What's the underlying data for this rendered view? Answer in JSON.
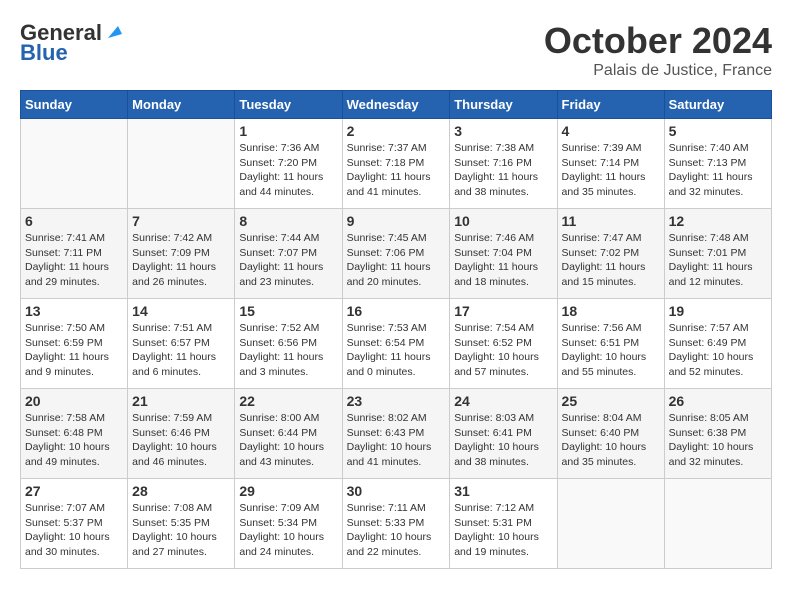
{
  "header": {
    "logo_line1": "General",
    "logo_line2": "Blue",
    "month_title": "October 2024",
    "location": "Palais de Justice, France"
  },
  "weekdays": [
    "Sunday",
    "Monday",
    "Tuesday",
    "Wednesday",
    "Thursday",
    "Friday",
    "Saturday"
  ],
  "weeks": [
    [
      {
        "day": "",
        "sunrise": "",
        "sunset": "",
        "daylight": ""
      },
      {
        "day": "",
        "sunrise": "",
        "sunset": "",
        "daylight": ""
      },
      {
        "day": "1",
        "sunrise": "Sunrise: 7:36 AM",
        "sunset": "Sunset: 7:20 PM",
        "daylight": "Daylight: 11 hours and 44 minutes."
      },
      {
        "day": "2",
        "sunrise": "Sunrise: 7:37 AM",
        "sunset": "Sunset: 7:18 PM",
        "daylight": "Daylight: 11 hours and 41 minutes."
      },
      {
        "day": "3",
        "sunrise": "Sunrise: 7:38 AM",
        "sunset": "Sunset: 7:16 PM",
        "daylight": "Daylight: 11 hours and 38 minutes."
      },
      {
        "day": "4",
        "sunrise": "Sunrise: 7:39 AM",
        "sunset": "Sunset: 7:14 PM",
        "daylight": "Daylight: 11 hours and 35 minutes."
      },
      {
        "day": "5",
        "sunrise": "Sunrise: 7:40 AM",
        "sunset": "Sunset: 7:13 PM",
        "daylight": "Daylight: 11 hours and 32 minutes."
      }
    ],
    [
      {
        "day": "6",
        "sunrise": "Sunrise: 7:41 AM",
        "sunset": "Sunset: 7:11 PM",
        "daylight": "Daylight: 11 hours and 29 minutes."
      },
      {
        "day": "7",
        "sunrise": "Sunrise: 7:42 AM",
        "sunset": "Sunset: 7:09 PM",
        "daylight": "Daylight: 11 hours and 26 minutes."
      },
      {
        "day": "8",
        "sunrise": "Sunrise: 7:44 AM",
        "sunset": "Sunset: 7:07 PM",
        "daylight": "Daylight: 11 hours and 23 minutes."
      },
      {
        "day": "9",
        "sunrise": "Sunrise: 7:45 AM",
        "sunset": "Sunset: 7:06 PM",
        "daylight": "Daylight: 11 hours and 20 minutes."
      },
      {
        "day": "10",
        "sunrise": "Sunrise: 7:46 AM",
        "sunset": "Sunset: 7:04 PM",
        "daylight": "Daylight: 11 hours and 18 minutes."
      },
      {
        "day": "11",
        "sunrise": "Sunrise: 7:47 AM",
        "sunset": "Sunset: 7:02 PM",
        "daylight": "Daylight: 11 hours and 15 minutes."
      },
      {
        "day": "12",
        "sunrise": "Sunrise: 7:48 AM",
        "sunset": "Sunset: 7:01 PM",
        "daylight": "Daylight: 11 hours and 12 minutes."
      }
    ],
    [
      {
        "day": "13",
        "sunrise": "Sunrise: 7:50 AM",
        "sunset": "Sunset: 6:59 PM",
        "daylight": "Daylight: 11 hours and 9 minutes."
      },
      {
        "day": "14",
        "sunrise": "Sunrise: 7:51 AM",
        "sunset": "Sunset: 6:57 PM",
        "daylight": "Daylight: 11 hours and 6 minutes."
      },
      {
        "day": "15",
        "sunrise": "Sunrise: 7:52 AM",
        "sunset": "Sunset: 6:56 PM",
        "daylight": "Daylight: 11 hours and 3 minutes."
      },
      {
        "day": "16",
        "sunrise": "Sunrise: 7:53 AM",
        "sunset": "Sunset: 6:54 PM",
        "daylight": "Daylight: 11 hours and 0 minutes."
      },
      {
        "day": "17",
        "sunrise": "Sunrise: 7:54 AM",
        "sunset": "Sunset: 6:52 PM",
        "daylight": "Daylight: 10 hours and 57 minutes."
      },
      {
        "day": "18",
        "sunrise": "Sunrise: 7:56 AM",
        "sunset": "Sunset: 6:51 PM",
        "daylight": "Daylight: 10 hours and 55 minutes."
      },
      {
        "day": "19",
        "sunrise": "Sunrise: 7:57 AM",
        "sunset": "Sunset: 6:49 PM",
        "daylight": "Daylight: 10 hours and 52 minutes."
      }
    ],
    [
      {
        "day": "20",
        "sunrise": "Sunrise: 7:58 AM",
        "sunset": "Sunset: 6:48 PM",
        "daylight": "Daylight: 10 hours and 49 minutes."
      },
      {
        "day": "21",
        "sunrise": "Sunrise: 7:59 AM",
        "sunset": "Sunset: 6:46 PM",
        "daylight": "Daylight: 10 hours and 46 minutes."
      },
      {
        "day": "22",
        "sunrise": "Sunrise: 8:00 AM",
        "sunset": "Sunset: 6:44 PM",
        "daylight": "Daylight: 10 hours and 43 minutes."
      },
      {
        "day": "23",
        "sunrise": "Sunrise: 8:02 AM",
        "sunset": "Sunset: 6:43 PM",
        "daylight": "Daylight: 10 hours and 41 minutes."
      },
      {
        "day": "24",
        "sunrise": "Sunrise: 8:03 AM",
        "sunset": "Sunset: 6:41 PM",
        "daylight": "Daylight: 10 hours and 38 minutes."
      },
      {
        "day": "25",
        "sunrise": "Sunrise: 8:04 AM",
        "sunset": "Sunset: 6:40 PM",
        "daylight": "Daylight: 10 hours and 35 minutes."
      },
      {
        "day": "26",
        "sunrise": "Sunrise: 8:05 AM",
        "sunset": "Sunset: 6:38 PM",
        "daylight": "Daylight: 10 hours and 32 minutes."
      }
    ],
    [
      {
        "day": "27",
        "sunrise": "Sunrise: 7:07 AM",
        "sunset": "Sunset: 5:37 PM",
        "daylight": "Daylight: 10 hours and 30 minutes."
      },
      {
        "day": "28",
        "sunrise": "Sunrise: 7:08 AM",
        "sunset": "Sunset: 5:35 PM",
        "daylight": "Daylight: 10 hours and 27 minutes."
      },
      {
        "day": "29",
        "sunrise": "Sunrise: 7:09 AM",
        "sunset": "Sunset: 5:34 PM",
        "daylight": "Daylight: 10 hours and 24 minutes."
      },
      {
        "day": "30",
        "sunrise": "Sunrise: 7:11 AM",
        "sunset": "Sunset: 5:33 PM",
        "daylight": "Daylight: 10 hours and 22 minutes."
      },
      {
        "day": "31",
        "sunrise": "Sunrise: 7:12 AM",
        "sunset": "Sunset: 5:31 PM",
        "daylight": "Daylight: 10 hours and 19 minutes."
      },
      {
        "day": "",
        "sunrise": "",
        "sunset": "",
        "daylight": ""
      },
      {
        "day": "",
        "sunrise": "",
        "sunset": "",
        "daylight": ""
      }
    ]
  ]
}
